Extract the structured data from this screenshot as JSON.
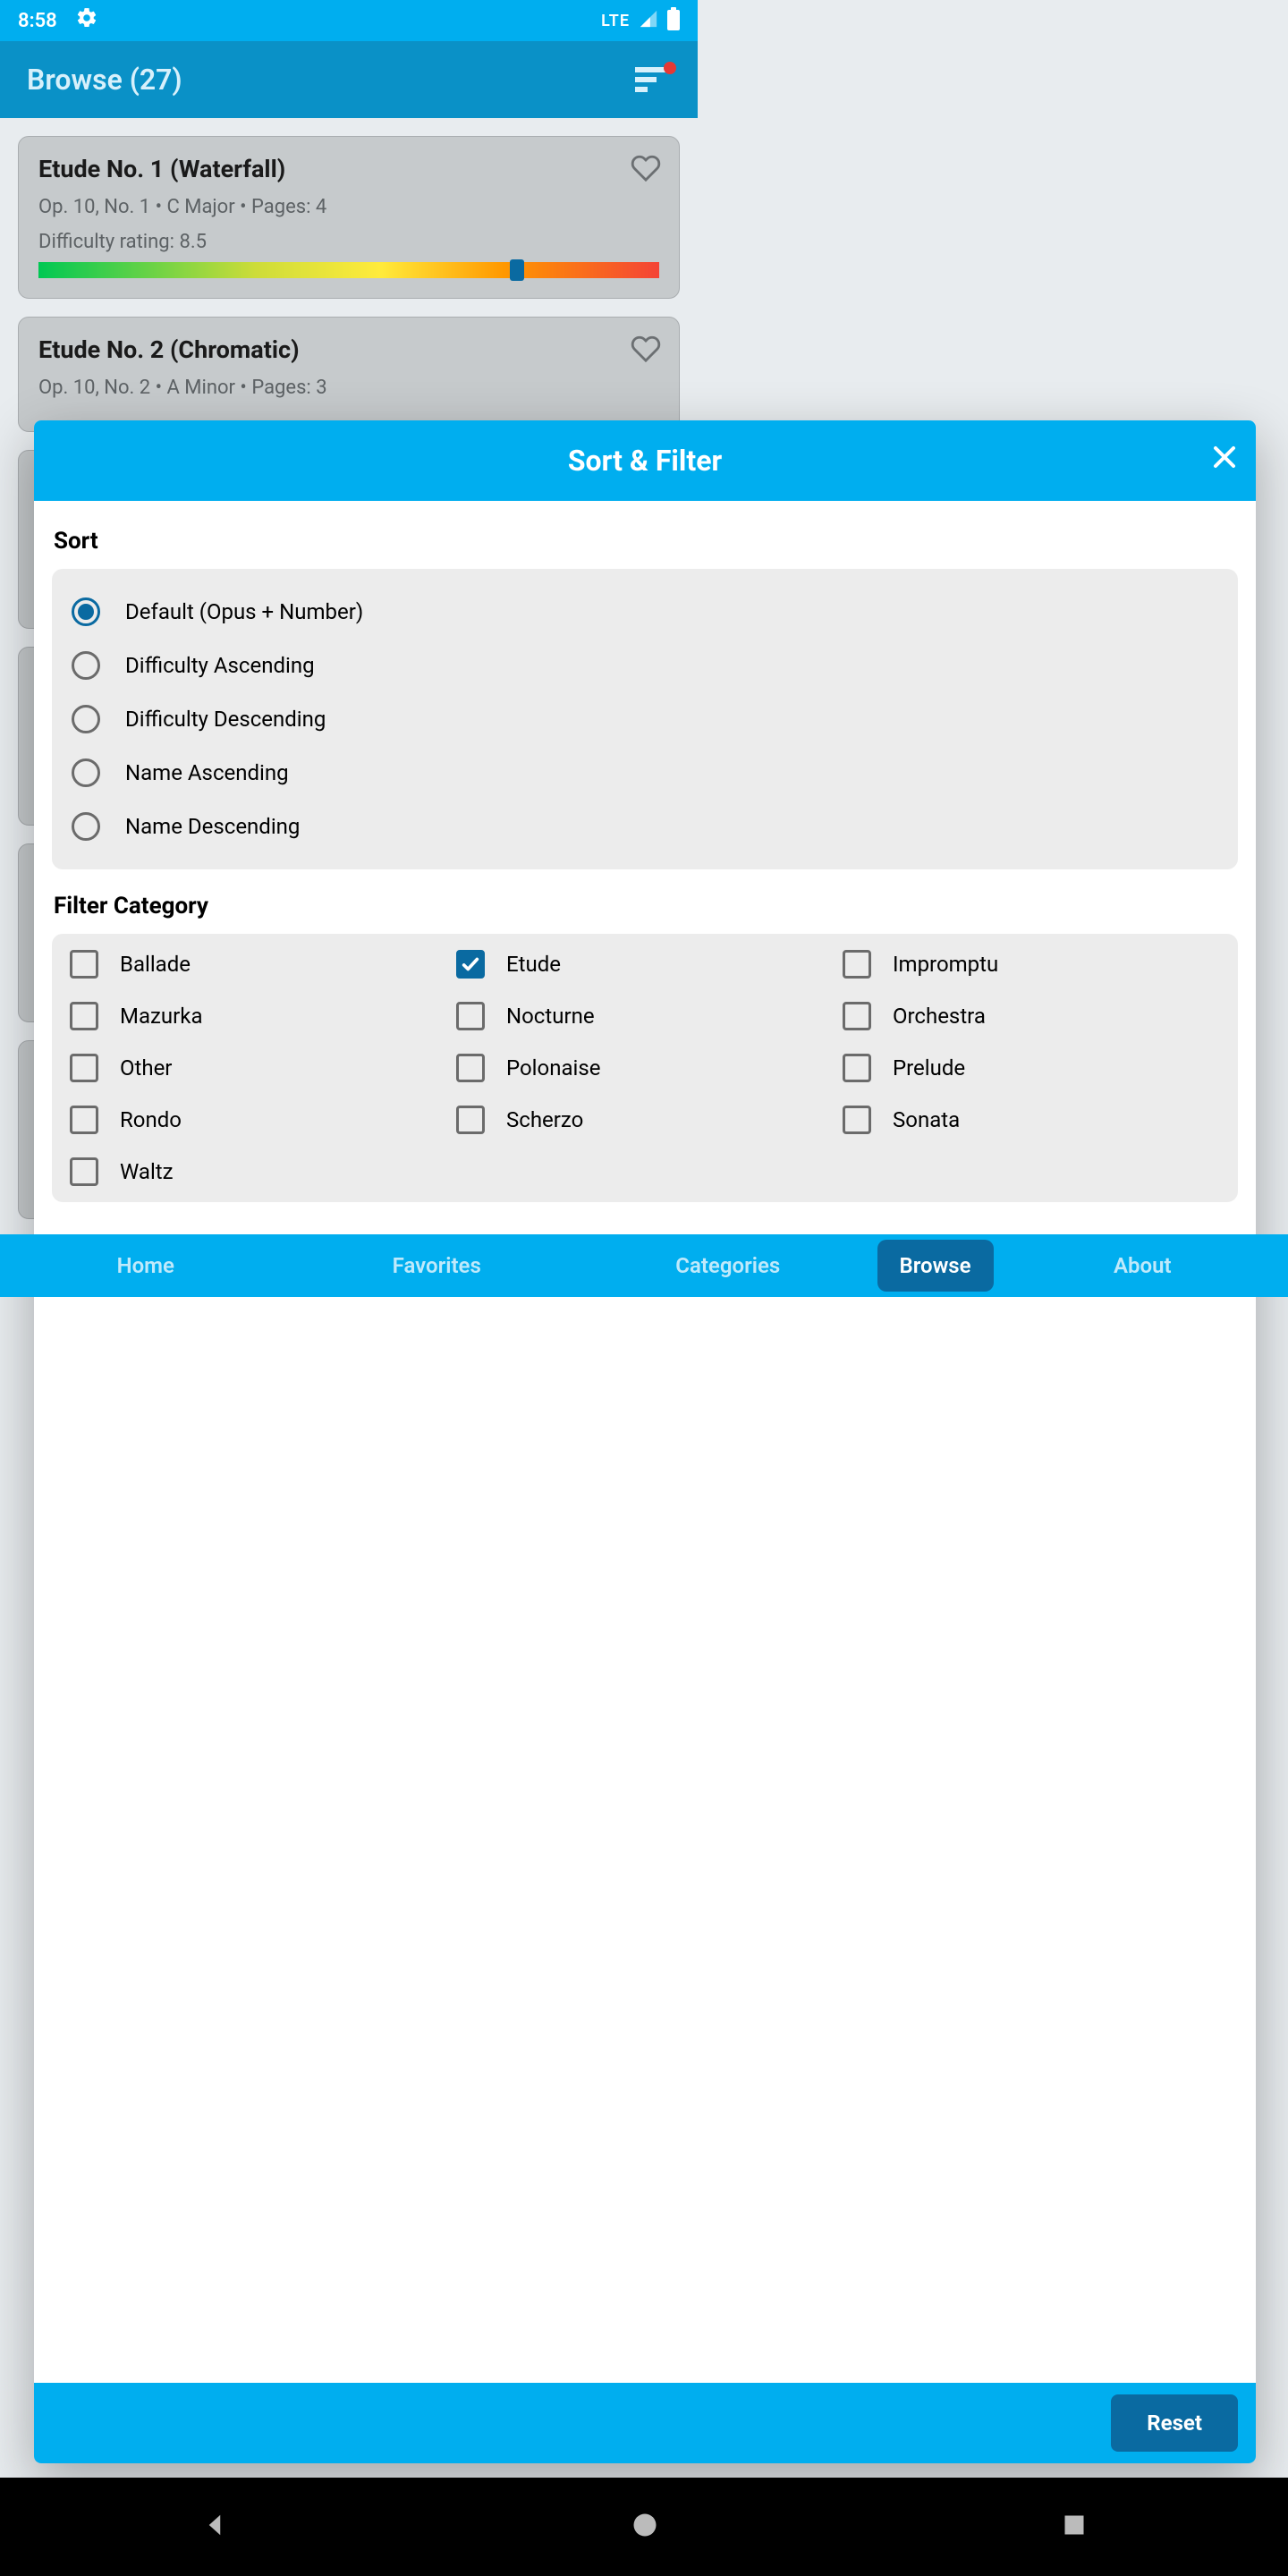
{
  "status": {
    "time": "8:58",
    "network": "LTE"
  },
  "header": {
    "title": "Browse (27)"
  },
  "items": [
    {
      "title": "Etude No. 1 (Waterfall)",
      "sub": "Op. 10, No. 1 • C Major • Pages: 4",
      "diff_label": "Difficulty rating: 8.5",
      "thumb_pct": 76
    },
    {
      "title": "Etude No. 2 (Chromatic)",
      "sub": "Op. 10, No. 2 • A Minor • Pages: 3"
    }
  ],
  "dialog": {
    "title": "Sort & Filter",
    "sort_title": "Sort",
    "sort_options": [
      {
        "label": "Default (Opus + Number)",
        "selected": true
      },
      {
        "label": "Difficulty Ascending",
        "selected": false
      },
      {
        "label": "Difficulty Descending",
        "selected": false
      },
      {
        "label": "Name Ascending",
        "selected": false
      },
      {
        "label": "Name Descending",
        "selected": false
      }
    ],
    "filter_title": "Filter Category",
    "categories": [
      {
        "label": "Ballade",
        "selected": false
      },
      {
        "label": "Etude",
        "selected": true
      },
      {
        "label": "Impromptu",
        "selected": false
      },
      {
        "label": "Mazurka",
        "selected": false
      },
      {
        "label": "Nocturne",
        "selected": false
      },
      {
        "label": "Orchestra",
        "selected": false
      },
      {
        "label": "Other",
        "selected": false
      },
      {
        "label": "Polonaise",
        "selected": false
      },
      {
        "label": "Prelude",
        "selected": false
      },
      {
        "label": "Rondo",
        "selected": false
      },
      {
        "label": "Scherzo",
        "selected": false
      },
      {
        "label": "Sonata",
        "selected": false
      },
      {
        "label": "Waltz",
        "selected": false
      }
    ],
    "reset": "Reset"
  },
  "tabs": {
    "home": "Home",
    "favorites": "Favorites",
    "categories": "Categories",
    "browse": "Browse",
    "about": "About"
  }
}
